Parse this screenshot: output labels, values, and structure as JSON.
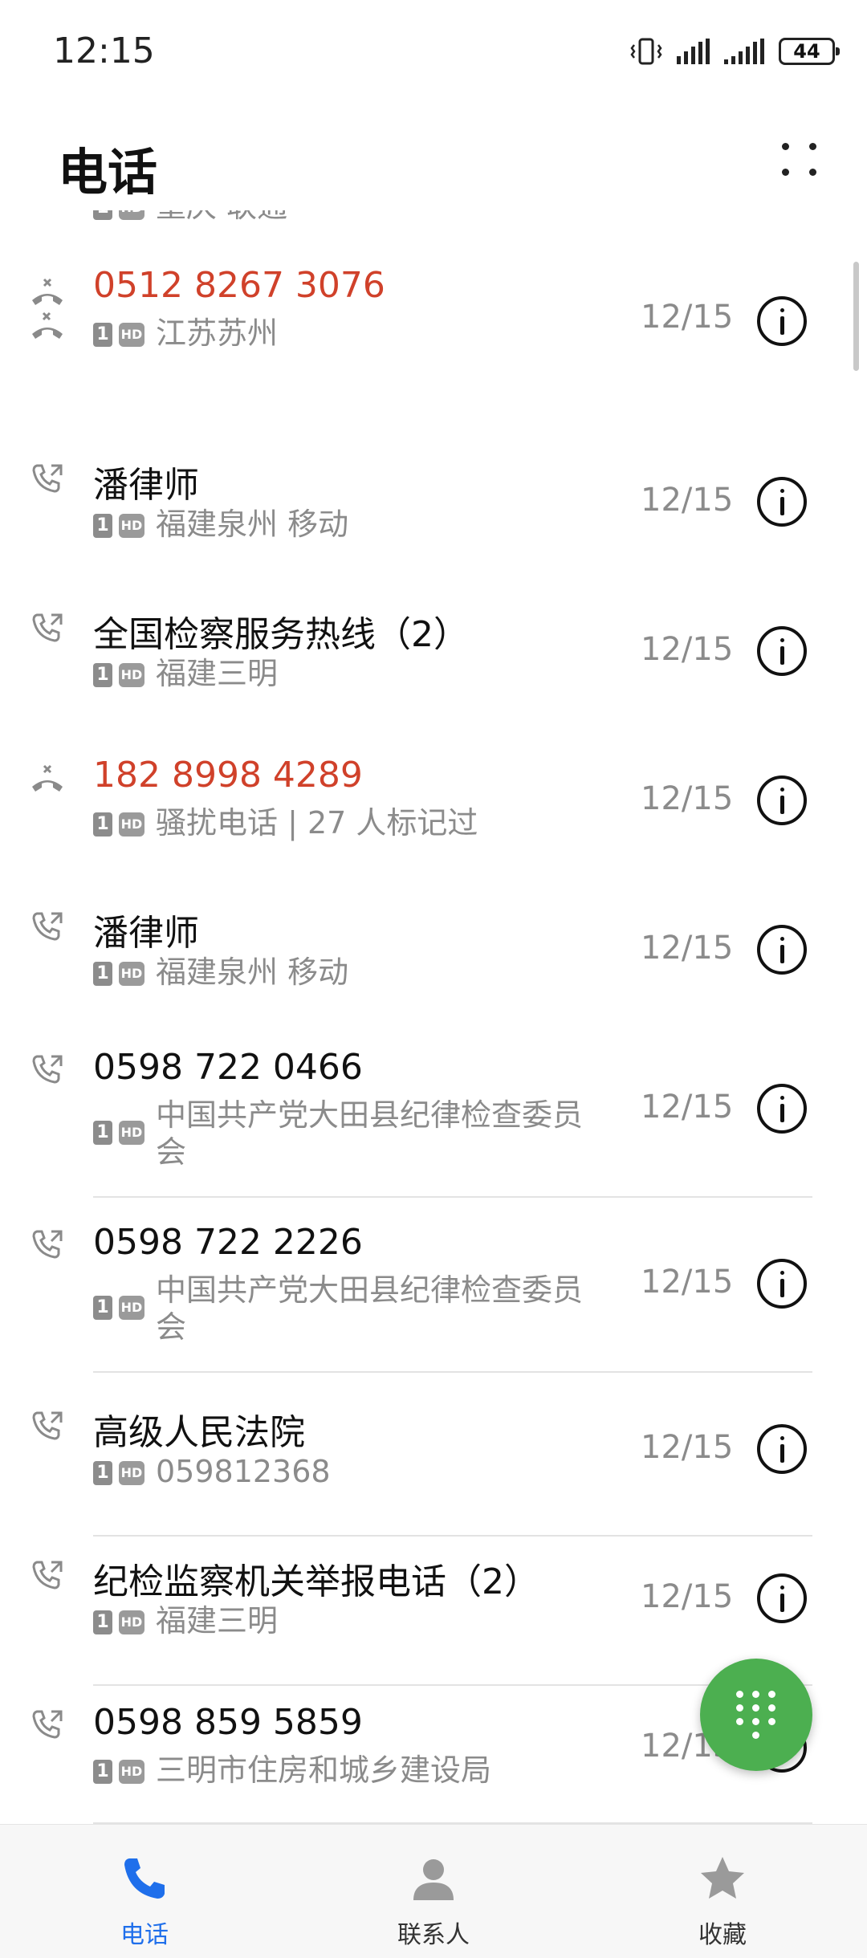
{
  "status_bar": {
    "time": "12:15",
    "battery": "44"
  },
  "header": {
    "title": "电话"
  },
  "partial_top_item": {
    "region": "重庆 联通"
  },
  "calls": [
    {
      "name": "0512 8267 3076",
      "type": "missed",
      "sim": "1",
      "hd": "HD",
      "detail": "江苏苏州",
      "date": "12/15"
    },
    {
      "name": "潘律师",
      "type": "outgoing",
      "sim": "1",
      "hd": "HD",
      "detail": "福建泉州 移动",
      "date": "12/15"
    },
    {
      "name": "全国检察服务热线（2）",
      "type": "outgoing",
      "sim": "1",
      "hd": "HD",
      "detail": "福建三明",
      "date": "12/15"
    },
    {
      "name": "182 8998 4289",
      "type": "missed",
      "sim": "1",
      "hd": "HD",
      "detail": "骚扰电话 | 27 人标记过",
      "date": "12/15"
    },
    {
      "name": "潘律师",
      "type": "outgoing",
      "sim": "1",
      "hd": "HD",
      "detail": "福建泉州 移动",
      "date": "12/15"
    },
    {
      "name": "0598 722 0466",
      "type": "outgoing",
      "sim": "1",
      "hd": "HD",
      "detail": "中国共产党大田县纪律检查委员会",
      "date": "12/15"
    },
    {
      "name": "0598 722 2226",
      "type": "outgoing",
      "sim": "1",
      "hd": "HD",
      "detail": "中国共产党大田县纪律检查委员会",
      "date": "12/15"
    },
    {
      "name": "高级人民法院",
      "type": "outgoing",
      "sim": "1",
      "hd": "HD",
      "detail": "059812368",
      "date": "12/15"
    },
    {
      "name": "纪检监察机关举报电话（2）",
      "type": "outgoing",
      "sim": "1",
      "hd": "HD",
      "detail": "福建三明",
      "date": "12/15"
    },
    {
      "name": "0598 859 5859",
      "type": "outgoing",
      "sim": "1",
      "hd": "HD",
      "detail": "三明市住房和城乡建设局",
      "date": "12/15"
    }
  ],
  "bottom_nav": {
    "tabs": [
      {
        "label": "电话",
        "active": true
      },
      {
        "label": "联系人",
        "active": false
      },
      {
        "label": "收藏",
        "active": false
      }
    ]
  },
  "colors": {
    "missed": "#d0412a",
    "fab": "#4caf50",
    "active_tab": "#1f6feb"
  }
}
